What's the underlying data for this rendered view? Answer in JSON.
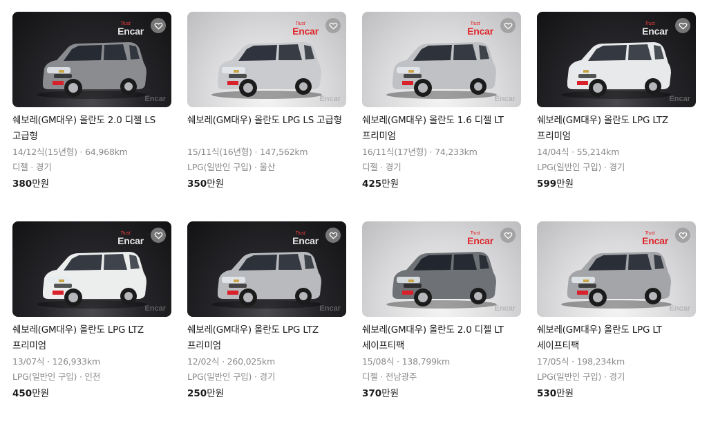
{
  "watermark": {
    "brand": "Encar",
    "tiny": "Trust"
  },
  "listings": [
    {
      "title": "쉐보레(GM대우) 올란도 2.0 디젤 LS 고급형",
      "year_km": "14/12식(15년형) · 64,968km",
      "fuel_region": "디젤 · 경기",
      "price_num": "380",
      "price_unit": "만원",
      "bg": "dark",
      "car_color": "#8a8c90"
    },
    {
      "title": "쉐보레(GM대우) 올란도 LPG LS 고급형",
      "year_km": "15/11식(16년형) · 147,562km",
      "fuel_region": "LPG(일반인 구입) · 울산",
      "price_num": "350",
      "price_unit": "만원",
      "bg": "light",
      "car_color": "#c9cbce"
    },
    {
      "title": "쉐보레(GM대우) 올란도 1.6 디젤 LT 프리미엄",
      "year_km": "16/11식(17년형) · 74,233km",
      "fuel_region": "디젤 · 경기",
      "price_num": "425",
      "price_unit": "만원",
      "bg": "light",
      "car_color": "#bfc1c4"
    },
    {
      "title": "쉐보레(GM대우) 올란도 LPG LTZ 프리미엄",
      "year_km": "14/04식 · 55,214km",
      "fuel_region": "LPG(일반인 구입) · 경기",
      "price_num": "599",
      "price_unit": "만원",
      "bg": "dark",
      "car_color": "#e8e9ea"
    },
    {
      "title": "쉐보레(GM대우) 올란도 LPG LTZ 프리미엄",
      "year_km": "13/07식 · 126,933km",
      "fuel_region": "LPG(일반인 구입) · 인천",
      "price_num": "450",
      "price_unit": "만원",
      "bg": "dark",
      "car_color": "#eceded"
    },
    {
      "title": "쉐보레(GM대우) 올란도 LPG LTZ 프리미엄",
      "year_km": "12/02식 · 260,025km",
      "fuel_region": "LPG(일반인 구입) · 경기",
      "price_num": "250",
      "price_unit": "만원",
      "bg": "dark",
      "car_color": "#b8babd"
    },
    {
      "title": "쉐보레(GM대우) 올란도 2.0 디젤 LT 세이프티팩",
      "year_km": "15/08식 · 138,799km",
      "fuel_region": "디젤 · 전남광주",
      "price_num": "370",
      "price_unit": "만원",
      "bg": "light",
      "car_color": "#6e7176"
    },
    {
      "title": "쉐보레(GM대우) 올란도 LPG LT 세이프티팩",
      "year_km": "17/05식 · 198,234km",
      "fuel_region": "LPG(일반인 구입) · 경기",
      "price_num": "530",
      "price_unit": "만원",
      "bg": "light",
      "car_color": "#a3a5a8"
    }
  ]
}
